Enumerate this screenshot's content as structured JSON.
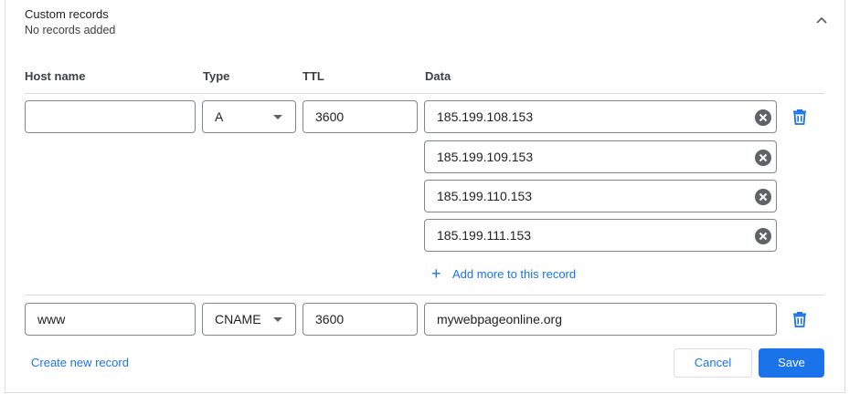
{
  "section": {
    "title": "Custom records",
    "subtitle": "No records added"
  },
  "columns": {
    "host": "Host name",
    "type": "Type",
    "ttl": "TTL",
    "data": "Data"
  },
  "records": [
    {
      "host": "",
      "type": "A",
      "ttl": "3600",
      "data": [
        "185.199.108.153",
        "185.199.109.153",
        "185.199.110.153",
        "185.199.111.153"
      ],
      "add_more_label": "Add more to this record"
    },
    {
      "host": "www",
      "type": "CNAME",
      "ttl": "3600",
      "data": [
        "mywebpageonline.org"
      ]
    }
  ],
  "actions": {
    "create_new": "Create new record",
    "cancel": "Cancel",
    "save": "Save"
  },
  "colors": {
    "accent": "#1a73e8",
    "border": "#80868b",
    "divider": "#dadce0",
    "clear_icon": "#5f6368"
  }
}
